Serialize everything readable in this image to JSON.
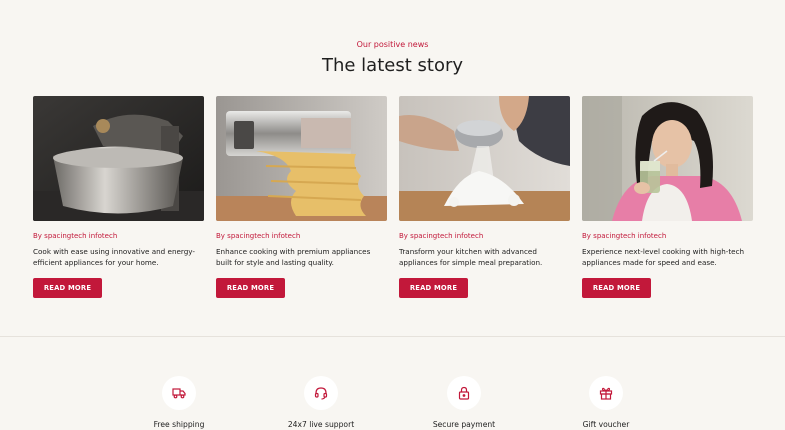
{
  "section": {
    "eyebrow": "Our positive news",
    "title": "The latest story"
  },
  "colors": {
    "accent": "#c2183a",
    "background": "#f8f6f2"
  },
  "cards": [
    {
      "image": "stand-mixer-photo",
      "byline": "By spacingtech infotech",
      "excerpt": "Cook with ease using innovative and energy-efficient appliances for your home.",
      "button": "READ MORE"
    },
    {
      "image": "pasta-maker-photo",
      "byline": "By spacingtech infotech",
      "excerpt": "Enhance cooking with premium appliances built for style and lasting quality.",
      "button": "READ MORE"
    },
    {
      "image": "flour-sifting-photo",
      "byline": "By spacingtech infotech",
      "excerpt": "Transform your kitchen with advanced appliances for simple meal preparation.",
      "button": "READ MORE"
    },
    {
      "image": "woman-drinking-smoothie-photo",
      "byline": "By spacingtech infotech",
      "excerpt": "Experience next-level cooking with high-tech appliances made for speed and ease.",
      "button": "READ MORE"
    }
  ],
  "features": [
    {
      "icon": "truck-icon",
      "label": "Free shipping"
    },
    {
      "icon": "headset-icon",
      "label": "24x7 live support"
    },
    {
      "icon": "lock-icon",
      "label": "Secure payment"
    },
    {
      "icon": "gift-icon",
      "label": "Gift voucher"
    }
  ]
}
